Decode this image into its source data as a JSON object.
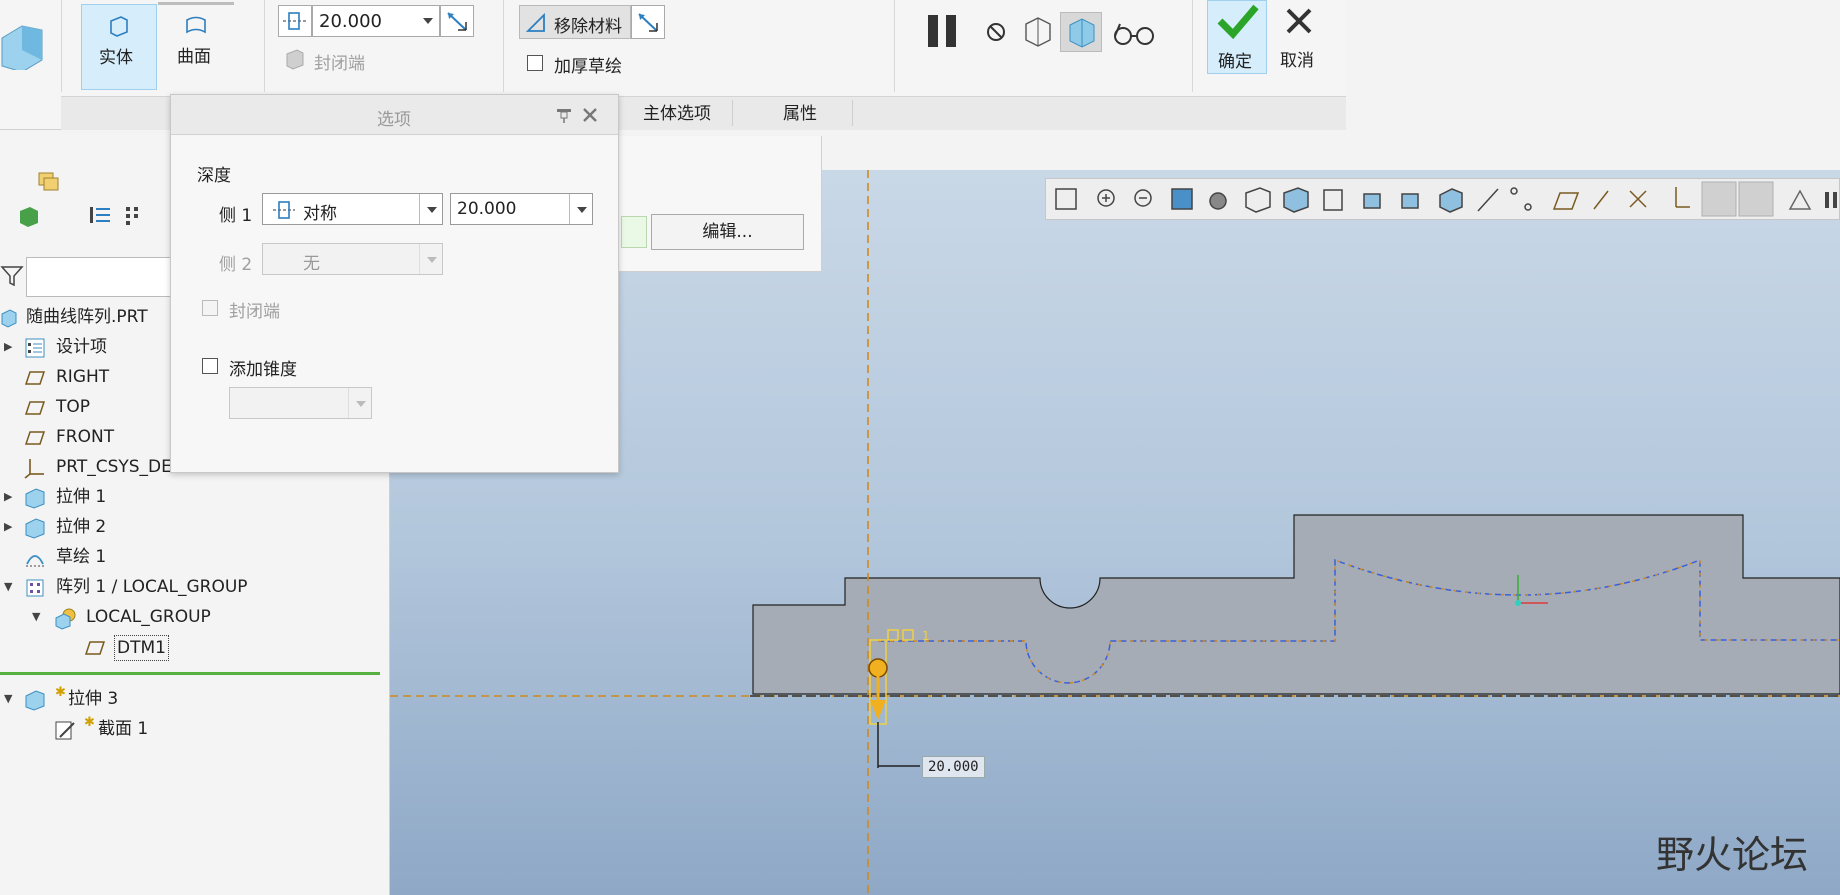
{
  "ribbon": {
    "type_solid": "实体",
    "type_surface": "曲面",
    "depth_value": "20.000",
    "capped_ends": "封闭端",
    "remove_material": "移除材料",
    "thicken_sketch": "加厚草绘",
    "ok": "确定",
    "cancel": "取消"
  },
  "tabs": {
    "body_options": "主体选项",
    "properties": "属性"
  },
  "options_dialog": {
    "title": "选项",
    "depth_label": "深度",
    "side1_label": "侧 1",
    "side1_type": "对称",
    "side1_value": "20.000",
    "side2_label": "侧 2",
    "side2_type": "无",
    "capped_ends": "封闭端",
    "add_taper": "添加锥度"
  },
  "placement_panel": {
    "edit_button": "编辑..."
  },
  "model_tree": {
    "items": [
      {
        "label": "随曲线阵列.PRT"
      },
      {
        "label": "设计项"
      },
      {
        "label": "RIGHT"
      },
      {
        "label": "TOP"
      },
      {
        "label": "FRONT"
      },
      {
        "label": "PRT_CSYS_DE."
      },
      {
        "label": "拉伸 1"
      },
      {
        "label": "拉伸 2"
      },
      {
        "label": "草绘 1"
      },
      {
        "label": "阵列 1 / LOCAL_GROUP"
      },
      {
        "label": "LOCAL_GROUP"
      },
      {
        "label": "DTM1"
      },
      {
        "label": "拉伸 3"
      },
      {
        "label": "截面 1"
      }
    ]
  },
  "graphics": {
    "dimension_value": "20.000",
    "watermark": "野火论坛"
  },
  "colors": {
    "accent": "#f0b020",
    "selection": "#d6eefb",
    "sketch_dash": "#3a5fd8",
    "confirm_green": "#2aa52a"
  }
}
